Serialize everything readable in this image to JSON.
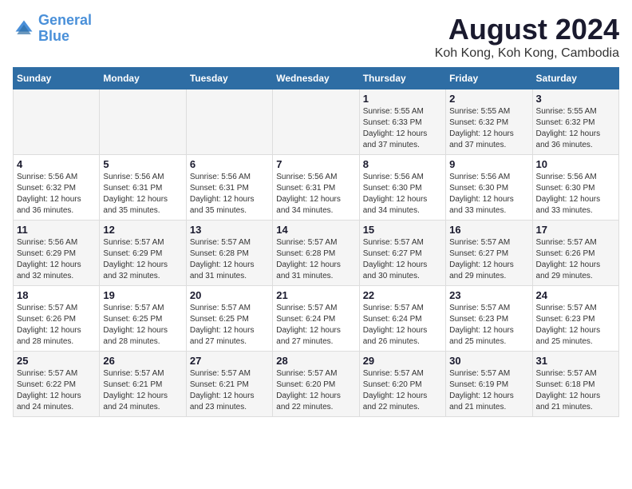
{
  "logo": {
    "line1": "General",
    "line2": "Blue"
  },
  "title": "August 2024",
  "subtitle": "Koh Kong, Koh Kong, Cambodia",
  "weekdays": [
    "Sunday",
    "Monday",
    "Tuesday",
    "Wednesday",
    "Thursday",
    "Friday",
    "Saturday"
  ],
  "weeks": [
    [
      {
        "day": "",
        "info": ""
      },
      {
        "day": "",
        "info": ""
      },
      {
        "day": "",
        "info": ""
      },
      {
        "day": "",
        "info": ""
      },
      {
        "day": "1",
        "info": "Sunrise: 5:55 AM\nSunset: 6:33 PM\nDaylight: 12 hours\nand 37 minutes."
      },
      {
        "day": "2",
        "info": "Sunrise: 5:55 AM\nSunset: 6:32 PM\nDaylight: 12 hours\nand 37 minutes."
      },
      {
        "day": "3",
        "info": "Sunrise: 5:55 AM\nSunset: 6:32 PM\nDaylight: 12 hours\nand 36 minutes."
      }
    ],
    [
      {
        "day": "4",
        "info": "Sunrise: 5:56 AM\nSunset: 6:32 PM\nDaylight: 12 hours\nand 36 minutes."
      },
      {
        "day": "5",
        "info": "Sunrise: 5:56 AM\nSunset: 6:31 PM\nDaylight: 12 hours\nand 35 minutes."
      },
      {
        "day": "6",
        "info": "Sunrise: 5:56 AM\nSunset: 6:31 PM\nDaylight: 12 hours\nand 35 minutes."
      },
      {
        "day": "7",
        "info": "Sunrise: 5:56 AM\nSunset: 6:31 PM\nDaylight: 12 hours\nand 34 minutes."
      },
      {
        "day": "8",
        "info": "Sunrise: 5:56 AM\nSunset: 6:30 PM\nDaylight: 12 hours\nand 34 minutes."
      },
      {
        "day": "9",
        "info": "Sunrise: 5:56 AM\nSunset: 6:30 PM\nDaylight: 12 hours\nand 33 minutes."
      },
      {
        "day": "10",
        "info": "Sunrise: 5:56 AM\nSunset: 6:30 PM\nDaylight: 12 hours\nand 33 minutes."
      }
    ],
    [
      {
        "day": "11",
        "info": "Sunrise: 5:56 AM\nSunset: 6:29 PM\nDaylight: 12 hours\nand 32 minutes."
      },
      {
        "day": "12",
        "info": "Sunrise: 5:57 AM\nSunset: 6:29 PM\nDaylight: 12 hours\nand 32 minutes."
      },
      {
        "day": "13",
        "info": "Sunrise: 5:57 AM\nSunset: 6:28 PM\nDaylight: 12 hours\nand 31 minutes."
      },
      {
        "day": "14",
        "info": "Sunrise: 5:57 AM\nSunset: 6:28 PM\nDaylight: 12 hours\nand 31 minutes."
      },
      {
        "day": "15",
        "info": "Sunrise: 5:57 AM\nSunset: 6:27 PM\nDaylight: 12 hours\nand 30 minutes."
      },
      {
        "day": "16",
        "info": "Sunrise: 5:57 AM\nSunset: 6:27 PM\nDaylight: 12 hours\nand 29 minutes."
      },
      {
        "day": "17",
        "info": "Sunrise: 5:57 AM\nSunset: 6:26 PM\nDaylight: 12 hours\nand 29 minutes."
      }
    ],
    [
      {
        "day": "18",
        "info": "Sunrise: 5:57 AM\nSunset: 6:26 PM\nDaylight: 12 hours\nand 28 minutes."
      },
      {
        "day": "19",
        "info": "Sunrise: 5:57 AM\nSunset: 6:25 PM\nDaylight: 12 hours\nand 28 minutes."
      },
      {
        "day": "20",
        "info": "Sunrise: 5:57 AM\nSunset: 6:25 PM\nDaylight: 12 hours\nand 27 minutes."
      },
      {
        "day": "21",
        "info": "Sunrise: 5:57 AM\nSunset: 6:24 PM\nDaylight: 12 hours\nand 27 minutes."
      },
      {
        "day": "22",
        "info": "Sunrise: 5:57 AM\nSunset: 6:24 PM\nDaylight: 12 hours\nand 26 minutes."
      },
      {
        "day": "23",
        "info": "Sunrise: 5:57 AM\nSunset: 6:23 PM\nDaylight: 12 hours\nand 25 minutes."
      },
      {
        "day": "24",
        "info": "Sunrise: 5:57 AM\nSunset: 6:23 PM\nDaylight: 12 hours\nand 25 minutes."
      }
    ],
    [
      {
        "day": "25",
        "info": "Sunrise: 5:57 AM\nSunset: 6:22 PM\nDaylight: 12 hours\nand 24 minutes."
      },
      {
        "day": "26",
        "info": "Sunrise: 5:57 AM\nSunset: 6:21 PM\nDaylight: 12 hours\nand 24 minutes."
      },
      {
        "day": "27",
        "info": "Sunrise: 5:57 AM\nSunset: 6:21 PM\nDaylight: 12 hours\nand 23 minutes."
      },
      {
        "day": "28",
        "info": "Sunrise: 5:57 AM\nSunset: 6:20 PM\nDaylight: 12 hours\nand 22 minutes."
      },
      {
        "day": "29",
        "info": "Sunrise: 5:57 AM\nSunset: 6:20 PM\nDaylight: 12 hours\nand 22 minutes."
      },
      {
        "day": "30",
        "info": "Sunrise: 5:57 AM\nSunset: 6:19 PM\nDaylight: 12 hours\nand 21 minutes."
      },
      {
        "day": "31",
        "info": "Sunrise: 5:57 AM\nSunset: 6:18 PM\nDaylight: 12 hours\nand 21 minutes."
      }
    ]
  ]
}
